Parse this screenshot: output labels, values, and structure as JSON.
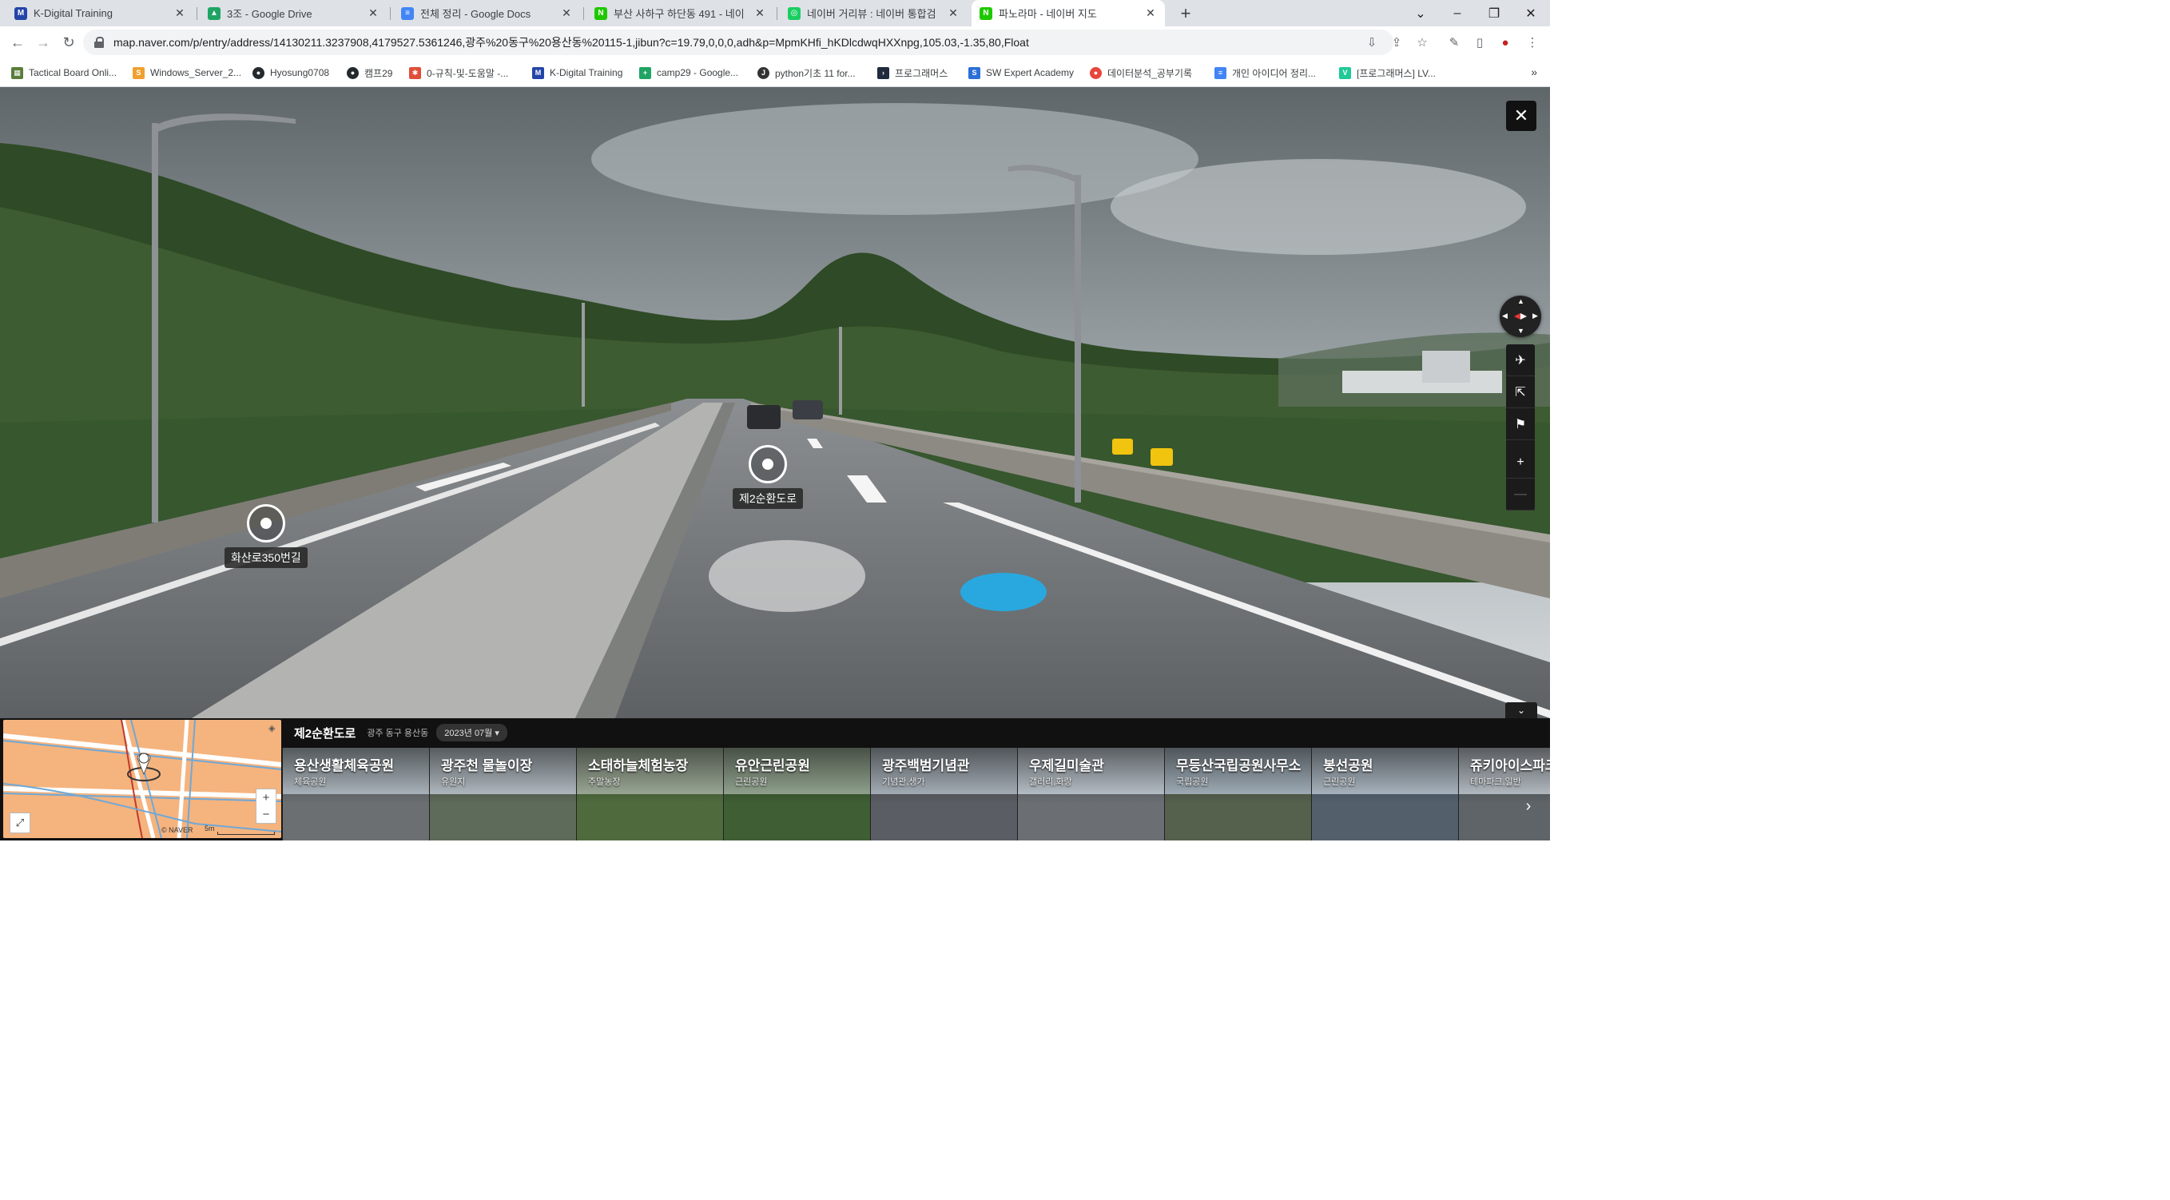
{
  "browser": {
    "tabs": [
      {
        "label": "K-Digital Training",
        "favicon": "M",
        "favicon_color": "#2445a8",
        "active": false
      },
      {
        "label": "3조 - Google Drive",
        "favicon": "▲",
        "favicon_color": "#1fa463",
        "active": false
      },
      {
        "label": "전체 정리 - Google Docs",
        "favicon": "≡",
        "favicon_color": "#4285f4",
        "active": false
      },
      {
        "label": "부산 사하구 하단동 491 - 네이",
        "favicon": "N",
        "favicon_color": "#1ec800",
        "active": false
      },
      {
        "label": "네이버 거리뷰 : 네이버 통합검",
        "favicon": "◎",
        "favicon_color": "#19ce60",
        "active": false
      },
      {
        "label": "파노라마 - 네이버 지도",
        "favicon": "N",
        "favicon_color": "#1ec800",
        "active": true
      }
    ],
    "new_tab_symbol": "+",
    "url": "map.naver.com/p/entry/address/14130211.3237908,4179527.5361246,광주%20동구%20용산동%20115-1,jibun?c=19.79,0,0,0,adh&p=MpmKHfi_hKDlcdwqHXXnpg,105.03,-1.35,80,Float",
    "bookmarks": [
      {
        "label": "Tactical Board Onli...",
        "color": "#5a7d3a",
        "glyph": "▦"
      },
      {
        "label": "Windows_Server_2...",
        "color": "#f0a030",
        "glyph": "S"
      },
      {
        "label": "Hyosung0708",
        "color": "#24292e",
        "glyph": "●"
      },
      {
        "label": "캠프29",
        "color": "#24292e",
        "glyph": "●"
      },
      {
        "label": "0-규칙-및-도움말 -...",
        "color": "#e04e39",
        "glyph": "✱"
      },
      {
        "label": "K-Digital Training",
        "color": "#2445a8",
        "glyph": "M"
      },
      {
        "label": "camp29 - Google...",
        "color": "#1fa463",
        "glyph": "+"
      },
      {
        "label": "python기초 11 for...",
        "color": "#333333",
        "glyph": "J"
      },
      {
        "label": "프로그래머스",
        "color": "#202b3d",
        "glyph": "›"
      },
      {
        "label": "SW Expert Academy",
        "color": "#2c6fd6",
        "glyph": "S"
      },
      {
        "label": "데이터분석_공부기록",
        "color": "#e8453c",
        "glyph": "●"
      },
      {
        "label": "개인 아이디어 정리...",
        "color": "#4285f4",
        "glyph": "≡"
      },
      {
        "label": "[프로그래머스] LV...",
        "color": "#20c997",
        "glyph": "V"
      }
    ],
    "bookmarks_more": "»",
    "window_controls": {
      "dropdown": "⌄",
      "minimize": "–",
      "restore": "❐",
      "close": "✕"
    }
  },
  "panorama": {
    "close_symbol": "✕",
    "markers": [
      {
        "label": "화산로350번길"
      },
      {
        "label": "제2순환도로"
      }
    ],
    "side_buttons": [
      {
        "icon": "airplane-icon",
        "glyph": "✈"
      },
      {
        "icon": "share-icon",
        "glyph": "⇱"
      },
      {
        "icon": "report-icon",
        "glyph": "⚑"
      },
      {
        "icon": "zoom-in-icon",
        "glyph": "+"
      },
      {
        "icon": "zoom-out-icon",
        "glyph": "—"
      }
    ],
    "collapse_symbol": "⌄"
  },
  "panel": {
    "road_title": "제2순환도로",
    "region": "광주 동구 용산동",
    "date": "2023년 07월 ▾",
    "minimap": {
      "attribution": "© NAVER",
      "scale": "5m",
      "zoom_in": "+",
      "zoom_out": "−",
      "expand": "⤢"
    },
    "places": [
      {
        "name": "용산생활체육공원",
        "category": "체육공원",
        "sky": "#b9c4cc",
        "ground": "#6c6f72"
      },
      {
        "name": "광주천 물놀이장",
        "category": "유원지",
        "sky": "#c0cad1",
        "ground": "#5e6a5a"
      },
      {
        "name": "소태하늘체험농장",
        "category": "주말농장",
        "sky": "#a9b7a3",
        "ground": "#4f6b3e"
      },
      {
        "name": "유안근린공원",
        "category": "근린공원",
        "sky": "#9eb19a",
        "ground": "#3f5e34"
      },
      {
        "name": "광주백범기념관",
        "category": "기념관,생가",
        "sky": "#b3bdc6",
        "ground": "#5a5d63"
      },
      {
        "name": "우제길미술관",
        "category": "갤러리,화랑",
        "sky": "#c6d0d8",
        "ground": "#6b6f74"
      },
      {
        "name": "무등산국립공원사무소",
        "category": "국립공원",
        "sky": "#aebcc7",
        "ground": "#55604d"
      },
      {
        "name": "봉선공원",
        "category": "근린공원",
        "sky": "#b7c4cf",
        "ground": "#53606b"
      },
      {
        "name": "쥬키아이스파크",
        "category": "테마파크,일반",
        "sky": "#c3cbd2",
        "ground": "#5f6468"
      }
    ],
    "next_symbol": "›"
  }
}
